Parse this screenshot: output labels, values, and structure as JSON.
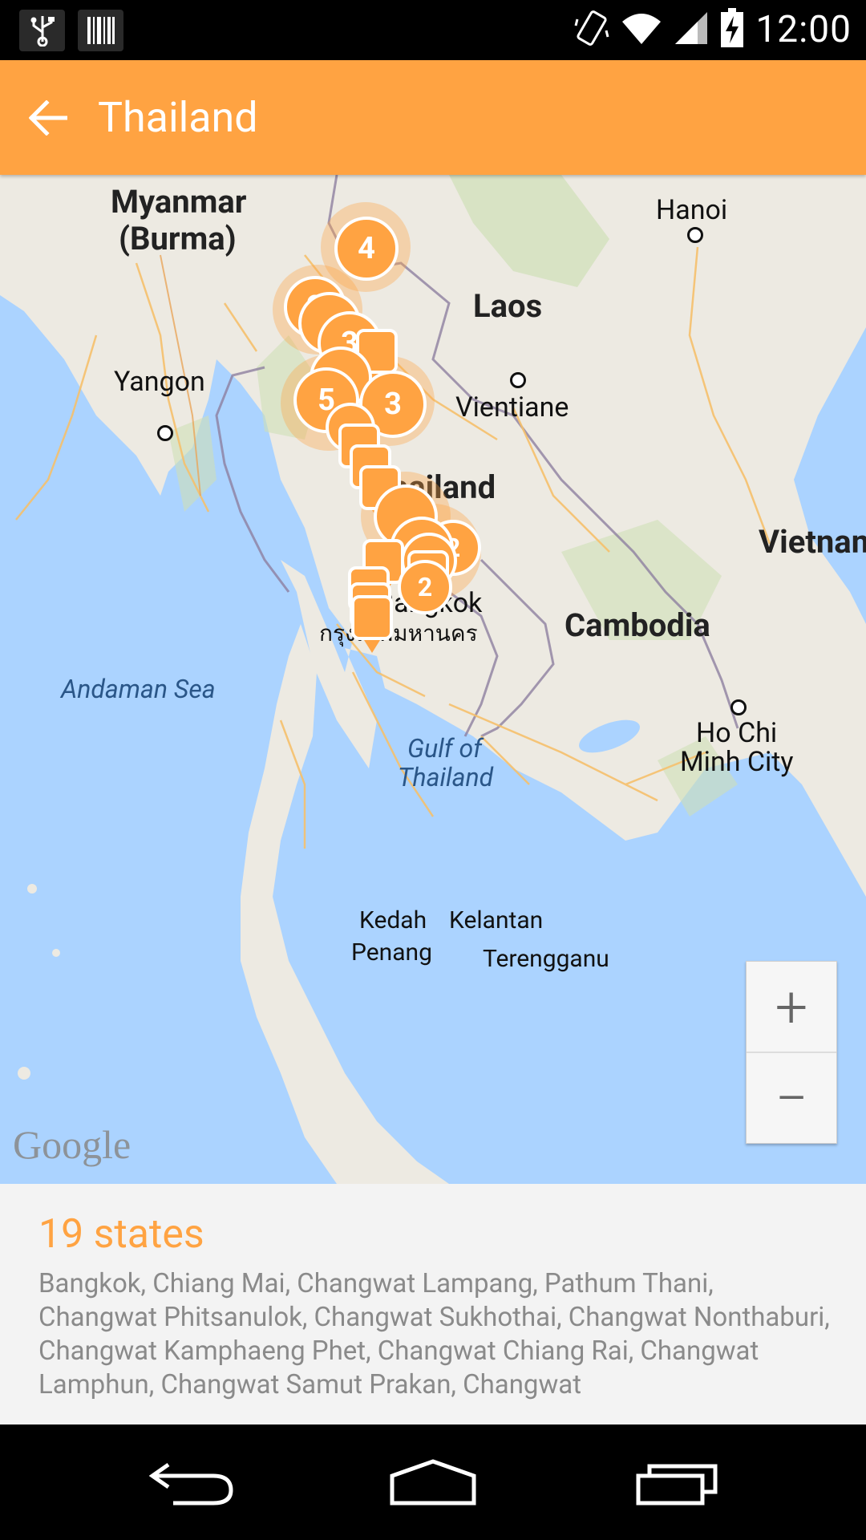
{
  "status_bar": {
    "time": "12:00",
    "icons": [
      "usb-icon",
      "barcode-icon",
      "vibrate-icon",
      "wifi-icon",
      "signal-icon",
      "battery-charging-icon"
    ]
  },
  "app_bar": {
    "title": "Thailand",
    "back_icon": "arrow-back-icon"
  },
  "map": {
    "labels": {
      "myanmar": "Myanmar",
      "burma": "(Burma)",
      "hanoi": "Hanoi",
      "laos": "Laos",
      "yangon": "Yangon",
      "vientiane": "Vientiane",
      "thailand": "Thailand",
      "vietnam": "Vietnam",
      "bangkok": "Bangkok",
      "bangkok_thai": "กรุงเทพมหานคร",
      "cambodia": "Cambodia",
      "andaman_sea": "Andaman Sea",
      "gulf": "Gulf of",
      "gulf2": "Thailand",
      "ho_chi": "Ho Chi",
      "minh_city": "Minh City",
      "kedah": "Kedah",
      "kelantan": "Kelantan",
      "penang": "Penang",
      "terengganu": "Terengganu"
    },
    "clusters": [
      {
        "count": "4"
      },
      {
        "count": "2"
      },
      {
        "count": "3"
      },
      {
        "count": "5"
      },
      {
        "count": "3"
      },
      {
        "count": "2"
      },
      {
        "count": "2"
      },
      {
        "count": "2"
      }
    ],
    "zoom_in": "+",
    "zoom_out": "−",
    "attribution": "Google",
    "marker_color": "#FFA342"
  },
  "info": {
    "title": "19 states",
    "states": "Bangkok, Chiang Mai, Changwat Lampang, Pathum Thani, Changwat Phitsanulok, Changwat Sukhothai, Changwat Nonthaburi, Changwat Kamphaeng Phet, Changwat Chiang Rai, Changwat Lamphun, Changwat Samut Prakan, Changwat"
  },
  "nav_bar": {
    "icons": [
      "back-nav-icon",
      "home-nav-icon",
      "recents-nav-icon"
    ]
  },
  "colors": {
    "accent": "#FFA342",
    "water": "#ABD3FF",
    "land": "#EDEAE2"
  }
}
